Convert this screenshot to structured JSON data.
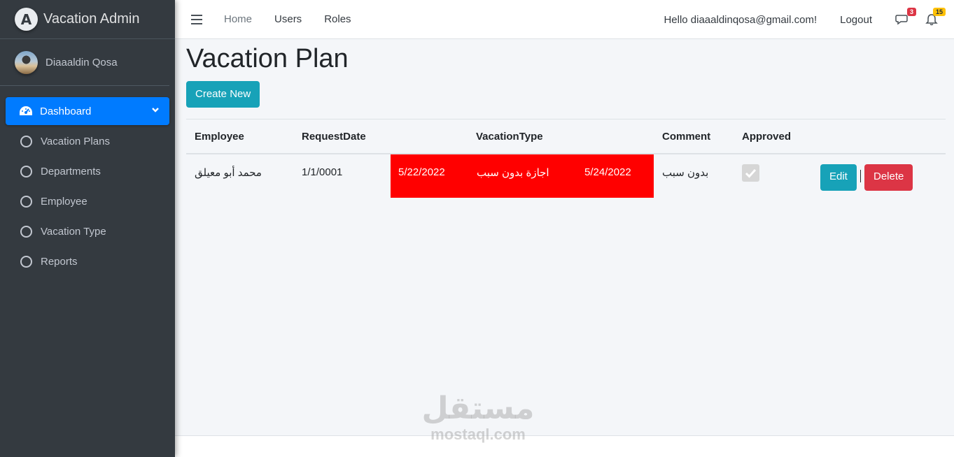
{
  "brand": {
    "logo_letter": "A",
    "title": "Vacation Admin"
  },
  "user": {
    "name": "Diaaaldin Qosa"
  },
  "sidebar": {
    "items": [
      {
        "label": "Dashboard",
        "icon": "tachometer-icon",
        "active": true
      },
      {
        "label": "Vacation Plans",
        "icon": "circle-icon"
      },
      {
        "label": "Departments",
        "icon": "circle-icon"
      },
      {
        "label": "Employee",
        "icon": "circle-icon"
      },
      {
        "label": "Vacation Type",
        "icon": "circle-icon"
      },
      {
        "label": "Reports",
        "icon": "circle-icon"
      }
    ]
  },
  "topbar": {
    "links": [
      "Home",
      "Users",
      "Roles"
    ],
    "hello": "Hello diaaaldinqosa@gmail.com!",
    "logout": "Logout",
    "messages_badge": "3",
    "notifications_badge": "15"
  },
  "page": {
    "title": "Vacation Plan",
    "create_button": "Create New"
  },
  "table": {
    "headers": [
      "Employee",
      "RequestDate",
      "VacationType",
      "Comment",
      "Approved"
    ],
    "rows": [
      {
        "employee": "محمد أبو معيلق",
        "request_date": "1/1/0001",
        "start_date": "5/22/2022",
        "vacation_type": "اجازة بدون سبب",
        "end_date": "5/24/2022",
        "comment": "بدون سبب",
        "approved": true,
        "edit": "Edit",
        "delete": "Delete"
      }
    ]
  },
  "watermark": {
    "arabic": "مستقل",
    "latin": "mostaql.com"
  },
  "colors": {
    "primary": "#007bff",
    "info": "#17a2b8",
    "danger": "#dc3545",
    "highlight": "#ff0000",
    "sidebar": "#343a40"
  }
}
